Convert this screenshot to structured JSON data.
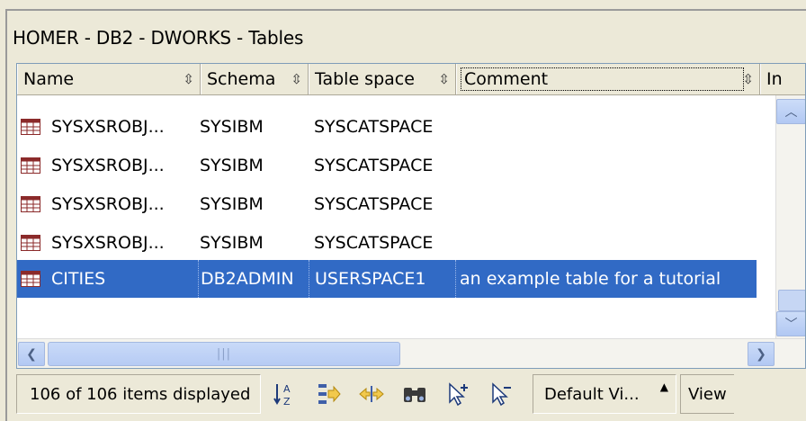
{
  "window": {
    "title": "HOMER - DB2 - DWORKS - Tables"
  },
  "columns": [
    {
      "label": "Name",
      "sort_icon": "sort-arrows-icon"
    },
    {
      "label": "Schema",
      "sort_icon": "sort-arrows-icon"
    },
    {
      "label": "Table space",
      "sort_icon": "sort-arrows-icon"
    },
    {
      "label": "Comment",
      "sort_icon": "sort-arrows-icon"
    },
    {
      "label": "In"
    }
  ],
  "rows": [
    {
      "name": "SYSXSROBJ...",
      "schema": "SYSIBM",
      "tablespace": "SYSCATSPACE",
      "comment": "",
      "selected": false
    },
    {
      "name": "SYSXSROBJ...",
      "schema": "SYSIBM",
      "tablespace": "SYSCATSPACE",
      "comment": "",
      "selected": false
    },
    {
      "name": "SYSXSROBJ...",
      "schema": "SYSIBM",
      "tablespace": "SYSCATSPACE",
      "comment": "",
      "selected": false
    },
    {
      "name": "SYSXSROBJ...",
      "schema": "SYSIBM",
      "tablespace": "SYSCATSPACE",
      "comment": "",
      "selected": false
    },
    {
      "name": "CITIES",
      "schema": "DB2ADMIN",
      "tablespace": "USERSPACE1",
      "comment": "an example table for a tutorial",
      "selected": true
    }
  ],
  "status": {
    "items_text": "106 of 106 items displayed",
    "view_select": "Default Vi...",
    "view_button": "View"
  },
  "toolbar_icons": [
    "sort-az-icon",
    "filter-icon",
    "columns-icon",
    "find-icon",
    "select-add-icon",
    "select-remove-icon"
  ],
  "colors": {
    "selection": "#316ac5",
    "chrome": "#ece9d8",
    "table_icon": "#8b2a2a"
  }
}
